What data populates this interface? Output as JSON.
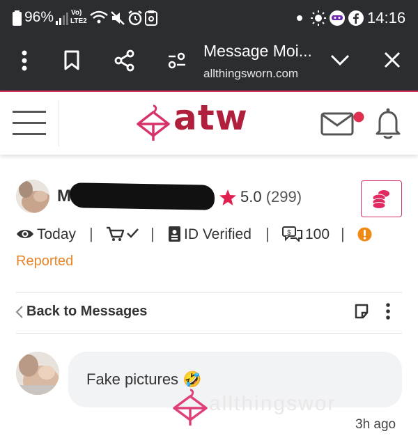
{
  "status_bar": {
    "battery": "96%",
    "volte": "Vo)",
    "lte": "LTE2",
    "time": "14:16"
  },
  "browser": {
    "page_title": "Message Moi...",
    "url": "allthingsworn.com"
  },
  "site": {
    "logo_text": "atw"
  },
  "profile": {
    "name_initial": "M",
    "rating": "5.0",
    "rating_count": "(299)",
    "last_seen": "Today",
    "id_status": "ID Verified",
    "message_count": "100",
    "reported_label": "Reported"
  },
  "thread": {
    "back_label": "Back to Messages"
  },
  "message": {
    "text": "Fake pictures",
    "emoji": "🤣",
    "watermark": "allthingswor",
    "timestamp": "3h ago"
  },
  "colors": {
    "brand": "#b0203c",
    "accent_pink": "#d6336c",
    "reported_orange": "#e8852a",
    "notification_red": "#e03050"
  }
}
